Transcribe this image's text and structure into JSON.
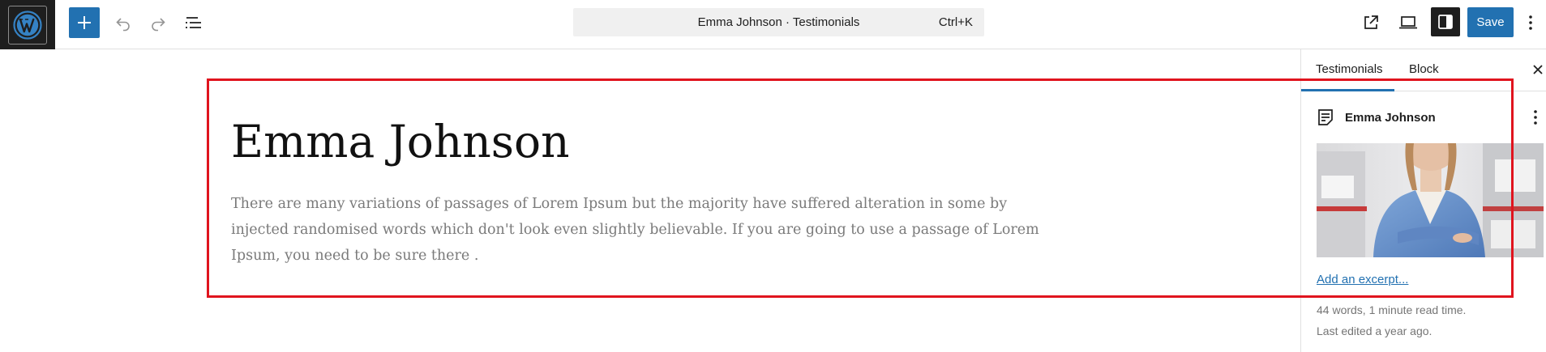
{
  "toolbar": {
    "command_bar_title": "Emma Johnson · Testimonials",
    "command_bar_shortcut": "Ctrl+K",
    "save_label": "Save",
    "accent_color": "#2271b1"
  },
  "post": {
    "title": "Emma Johnson",
    "body": "There are many variations of passages of Lorem Ipsum but the majority have suffered alteration in some by injected randomised words which don't look even slightly believable. If you are going to use a passage of Lorem Ipsum, you need to be sure there ."
  },
  "sidebar": {
    "tabs": [
      {
        "label": "Testimonials",
        "active": true
      },
      {
        "label": "Block",
        "active": false
      }
    ],
    "post_name": "Emma Johnson",
    "excerpt_link": "Add an excerpt...",
    "meta": [
      "44 words, 1 minute read time.",
      "Last edited a year ago."
    ]
  },
  "icons": {
    "logo": "wordpress-logo-icon",
    "inserter": "plus-icon",
    "undo": "undo-icon",
    "redo": "redo-icon",
    "list_view": "list-view-icon",
    "preview": "external-link-icon",
    "device": "laptop-icon",
    "settings": "sidebar-toggle-icon",
    "options": "vertical-dots-icon",
    "close": "close-icon",
    "post": "post-document-icon"
  },
  "highlight_color": "#e0141e"
}
